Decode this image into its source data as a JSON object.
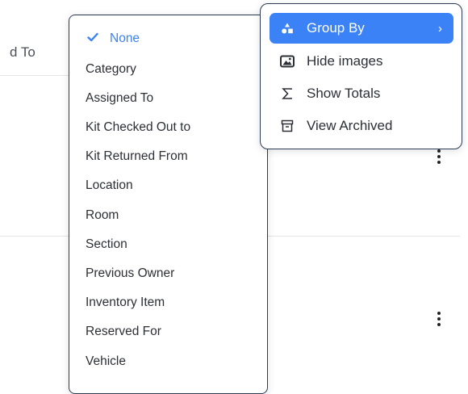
{
  "background": {
    "header_fragment": "d To"
  },
  "menu": {
    "items": [
      {
        "label": "Group By",
        "icon": "group-shapes-icon",
        "active": true,
        "has_submenu": true
      },
      {
        "label": "Hide images",
        "icon": "image-icon"
      },
      {
        "label": "Show Totals",
        "icon": "sigma-icon"
      },
      {
        "label": "View Archived",
        "icon": "archive-box-icon"
      }
    ],
    "chevron": "›"
  },
  "group_by": {
    "selected": "None",
    "options": [
      "None",
      "Category",
      "Assigned To",
      "Kit Checked Out to",
      "Kit Returned From",
      "Location",
      "Room",
      "Section",
      "Previous Owner",
      "Inventory Item",
      "Reserved For",
      "Vehicle"
    ]
  },
  "colors": {
    "accent": "#3b82f6",
    "menu_border": "#2b3a55",
    "divider": "#e3e5e8"
  }
}
